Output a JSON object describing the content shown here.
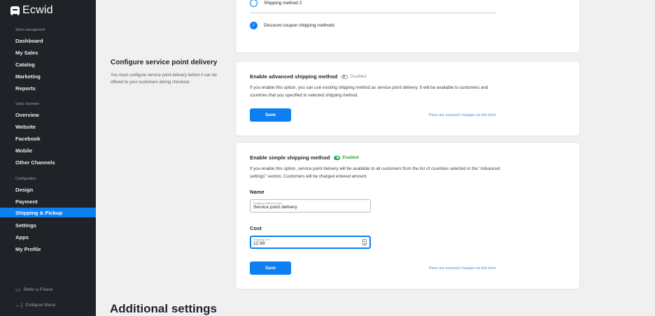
{
  "sidebar": {
    "logo_text": "Ecwid",
    "sections": {
      "store_management": "Store management",
      "sales_channels": "Sales channels",
      "configuration": "Configuration"
    },
    "items": [
      {
        "label": "Dashboard"
      },
      {
        "label": "My Sales"
      },
      {
        "label": "Catalog"
      },
      {
        "label": "Marketing"
      },
      {
        "label": "Reports"
      },
      {
        "label": "Overview"
      },
      {
        "label": "Website"
      },
      {
        "label": "Facebook"
      },
      {
        "label": "Mobile"
      },
      {
        "label": "Other Channels"
      },
      {
        "label": "Design"
      },
      {
        "label": "Payment"
      },
      {
        "label": "Shipping & Pickup",
        "active": true
      },
      {
        "label": "Settings"
      },
      {
        "label": "Apps"
      },
      {
        "label": "My Profile"
      }
    ],
    "footer": {
      "refer": "Refer a Friend",
      "collapse": "Collapse Menu"
    },
    "active_color": "#0d7ff0"
  },
  "top_card": {
    "option1": "Shipping method 2",
    "option2": "Discount coupon shipping methods"
  },
  "service_point": {
    "heading": "Configure service point delivery",
    "description": "You must configure service point delivery before it can be offered to your customers during checkout."
  },
  "advanced_card": {
    "title": "Enable advanced shipping method",
    "status": "Disabled",
    "description": "If you enable this option, you can use existing shipping method as service point delivery. It will be available to customers and countries that you specified in selected shipping method.",
    "save_label": "Save",
    "unsaved_note": "There are unsaved changes on this form."
  },
  "simple_card": {
    "title": "Enable simple shipping method",
    "status": "Enabled",
    "description": "If you enable this option, service point delivery will be available to all customers from the list of countries selected in the \"Advanced settings\" section. Customers will be charged entered amount.",
    "name_label": "Name",
    "name_placeholder": "Shipping method name",
    "name_value": "Service point delivery",
    "cost_label": "Cost",
    "cost_placeholder": "Shipping cost",
    "cost_value": "12.99",
    "save_label": "Save",
    "unsaved_note": "There are unsaved changes on this form."
  },
  "additional_heading": "Additional settings",
  "colors": {
    "accent": "#0d7ff0",
    "enabled": "#2ea84a",
    "sidebar_bg": "#1f2328"
  }
}
